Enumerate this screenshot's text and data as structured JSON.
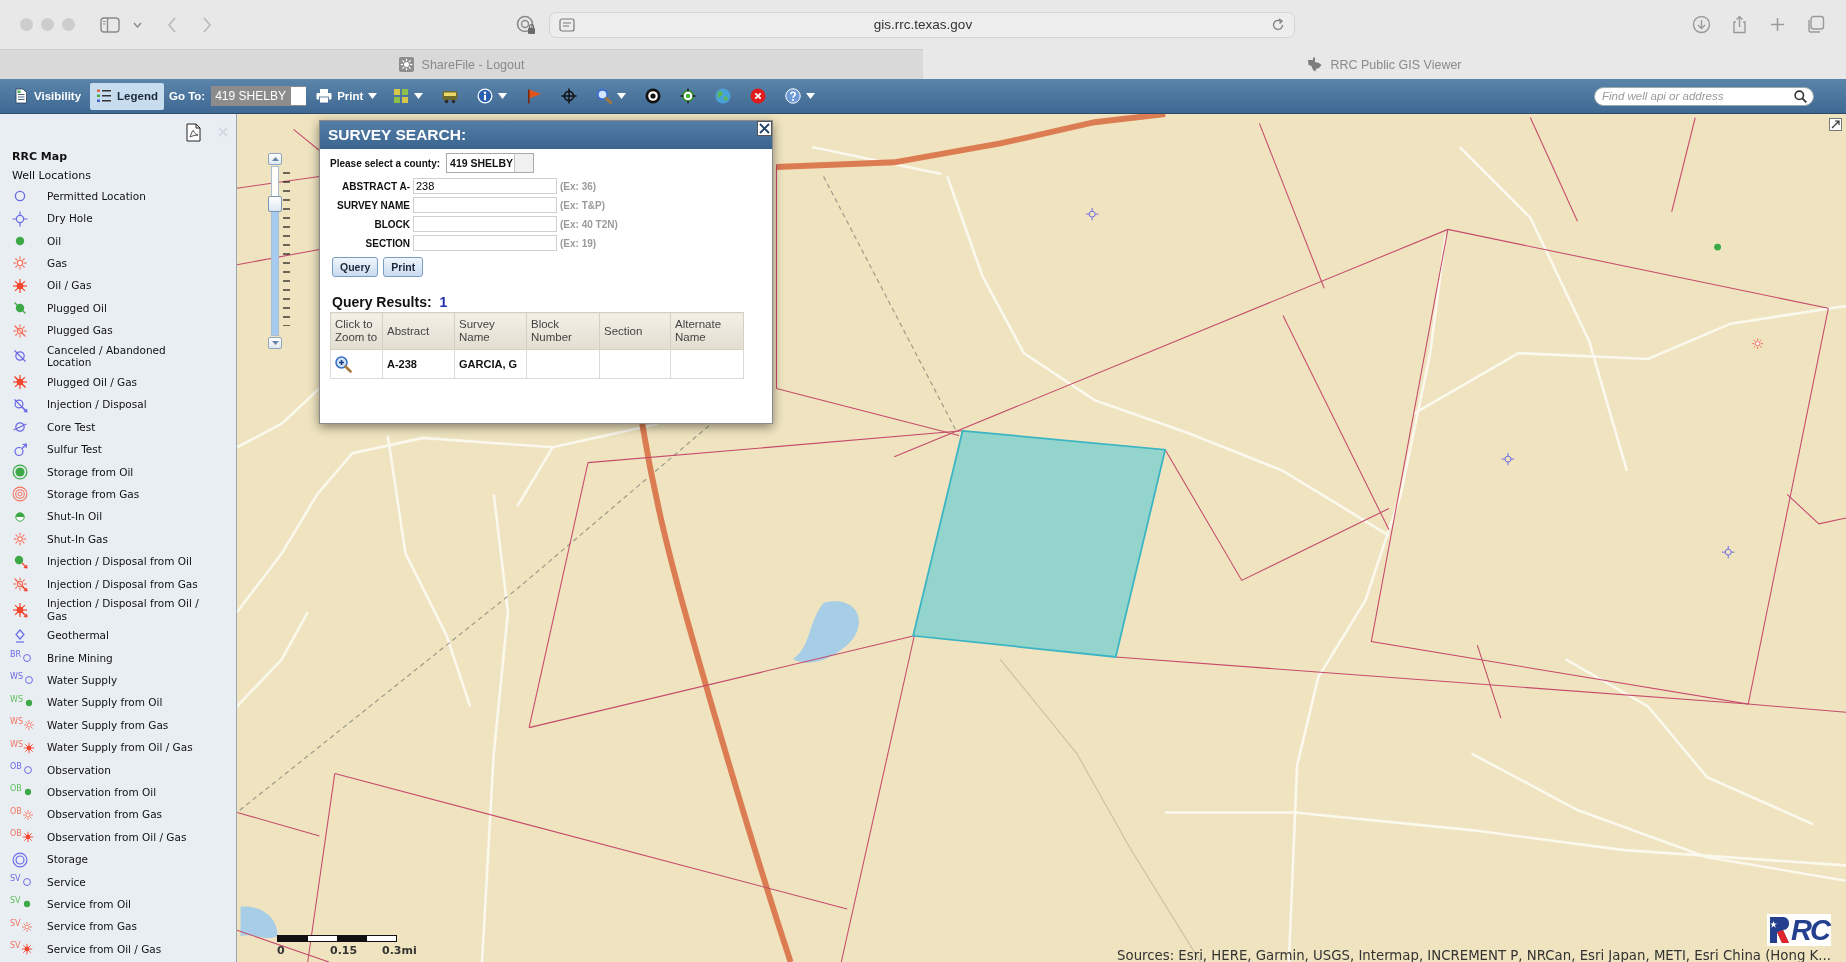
{
  "browser": {
    "url": "gis.rrc.texas.gov",
    "tabs": [
      {
        "label": "ShareFile - Logout",
        "selected": false
      },
      {
        "label": "RRC Public GIS Viewer",
        "selected": true
      }
    ]
  },
  "toolbar": {
    "buttons": [
      {
        "label": "Visibility",
        "kind": "visibility",
        "selected": false
      },
      {
        "label": "Legend",
        "kind": "legend",
        "selected": true
      }
    ],
    "goto": {
      "label": "Go To:",
      "value": "419 SHELBY"
    },
    "print": {
      "label": "Print",
      "dropdown": true
    },
    "tools": [
      {
        "kind": "layers",
        "dropdown": true
      },
      {
        "kind": "vehicle",
        "dropdown": false
      },
      {
        "kind": "info",
        "dropdown": true
      },
      {
        "kind": "flag",
        "dropdown": false
      },
      {
        "kind": "crosshair",
        "dropdown": false
      },
      {
        "kind": "zoom",
        "dropdown": true
      },
      {
        "kind": "target",
        "dropdown": false
      },
      {
        "kind": "locate",
        "dropdown": false
      },
      {
        "kind": "globe",
        "dropdown": false
      },
      {
        "kind": "clear",
        "dropdown": false
      },
      {
        "kind": "help",
        "dropdown": true
      }
    ],
    "search": {
      "placeholder": "Find well api or address"
    }
  },
  "legend": {
    "title": "RRC Map",
    "group": "Well Locations",
    "items": [
      {
        "label": "Permitted Location",
        "kind": "permitted"
      },
      {
        "label": "Dry Hole",
        "kind": "dry_hole"
      },
      {
        "label": "Oil",
        "kind": "oil"
      },
      {
        "label": "Gas",
        "kind": "gas"
      },
      {
        "label": "Oil / Gas",
        "kind": "oil_gas"
      },
      {
        "label": "Plugged Oil",
        "kind": "plugged_oil"
      },
      {
        "label": "Plugged Gas",
        "kind": "plugged_gas"
      },
      {
        "label": "Canceled / Abandoned Location",
        "kind": "canceled"
      },
      {
        "label": "Plugged Oil / Gas",
        "kind": "plugged_oil_gas"
      },
      {
        "label": "Injection / Disposal",
        "kind": "injection"
      },
      {
        "label": "Core Test",
        "kind": "core_test"
      },
      {
        "label": "Sulfur Test",
        "kind": "sulfur_test"
      },
      {
        "label": "Storage from Oil",
        "kind": "storage_oil"
      },
      {
        "label": "Storage from Gas",
        "kind": "storage_gas"
      },
      {
        "label": "Shut-In Oil",
        "kind": "shut_in_oil"
      },
      {
        "label": "Shut-In Gas",
        "kind": "shut_in_gas"
      },
      {
        "label": "Injection / Disposal from Oil",
        "kind": "injection_oil"
      },
      {
        "label": "Injection / Disposal from Gas",
        "kind": "injection_gas"
      },
      {
        "label": "Injection / Disposal from Oil / Gas",
        "kind": "injection_oil_gas"
      },
      {
        "label": "Geothermal",
        "kind": "geothermal"
      },
      {
        "label": "Brine Mining",
        "kind": "permitted",
        "prefix": "BR"
      },
      {
        "label": "Water Supply",
        "kind": "permitted",
        "prefix": "WS"
      },
      {
        "label": "Water Supply from Oil",
        "kind": "oil",
        "prefix": "WS"
      },
      {
        "label": "Water Supply from Gas",
        "kind": "gas",
        "prefix": "WS"
      },
      {
        "label": "Water Supply from Oil / Gas",
        "kind": "oil_gas",
        "prefix": "WS"
      },
      {
        "label": "Observation",
        "kind": "permitted",
        "prefix": "OB"
      },
      {
        "label": "Observation from Oil",
        "kind": "oil",
        "prefix": "OB"
      },
      {
        "label": "Observation from Gas",
        "kind": "gas",
        "prefix": "OB"
      },
      {
        "label": "Observation from Oil / Gas",
        "kind": "oil_gas",
        "prefix": "OB"
      },
      {
        "label": "Storage",
        "kind": "storage"
      },
      {
        "label": "Service",
        "kind": "permitted",
        "prefix": "SV"
      },
      {
        "label": "Service from Oil",
        "kind": "oil",
        "prefix": "SV"
      },
      {
        "label": "Service from Gas",
        "kind": "gas",
        "prefix": "SV"
      },
      {
        "label": "Service from Oil / Gas",
        "kind": "oil_gas",
        "prefix": "SV"
      }
    ]
  },
  "survey_search": {
    "title": "SURVEY SEARCH:",
    "county_label": "Please select a county:",
    "county_value": "419 SHELBY",
    "fields": [
      {
        "label": "ABSTRACT A-",
        "value": "238",
        "example": "(Ex: 36)"
      },
      {
        "label": "SURVEY NAME",
        "example": "(Ex: T&P)"
      },
      {
        "label": "BLOCK",
        "example": "(Ex: 40 T2N)"
      },
      {
        "label": "SECTION",
        "example": "(Ex: 19)"
      }
    ],
    "buttons": [
      "Query",
      "Print"
    ],
    "results_label": "Query Results:",
    "results_count": "1",
    "table": {
      "columns": [
        "Click to Zoom to",
        "Abstract",
        "Survey Name",
        "Block Number",
        "Section",
        "Alternate Name"
      ],
      "rows": [
        {
          "abstract": "A-238",
          "survey_name": "GARCIA, G"
        }
      ]
    }
  },
  "map": {
    "zoom_slider": {
      "level": 0.78
    },
    "scale_labels": [
      "0",
      "0.15",
      "0.3mi"
    ],
    "attribution": "Sources: Esri, HERE, Garmin, USGS, Intermap, INCREMENT P, NRCan, Esri Japan, METI, Esri China (Hong K...",
    "logo": "RC"
  }
}
